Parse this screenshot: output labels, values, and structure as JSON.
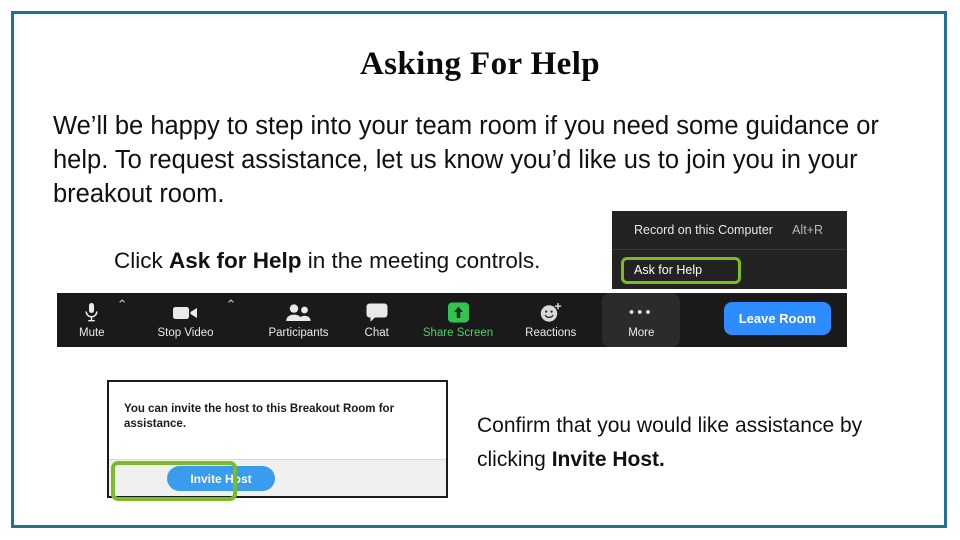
{
  "slide": {
    "title": "Asking For Help",
    "border_color": "#1F7391",
    "intro": "We’ll be happy to step into your team room if you need some guidance or help. To request assistance, let us know you’d like us to join you in your breakout room.",
    "click_instruction": {
      "before": "Click ",
      "bold": "Ask for Help",
      "after": " in the meeting controls."
    },
    "confirm_instruction": {
      "before": "Confirm that you would like assistance by clicking ",
      "bold": "Invite Host.",
      "after": ""
    }
  },
  "more_menu": {
    "background": "#232323",
    "highlight_color": "#79BC27",
    "items": [
      {
        "label": "Record on this Computer",
        "shortcut": "Alt+R"
      },
      {
        "label": "Ask for Help",
        "shortcut": ""
      }
    ]
  },
  "zoom_bar": {
    "background": "#1a1a1a",
    "share_screen_green": "#4fd06a",
    "leave_button_color": "#2D8CFF",
    "controls": [
      {
        "label": "Mute",
        "icon": "microphone-icon",
        "caret": "⌃"
      },
      {
        "label": "Stop Video",
        "icon": "video-camera-icon",
        "caret": "⌃"
      },
      {
        "label": "Participants",
        "icon": "participants-icon",
        "caret": ""
      },
      {
        "label": "Chat",
        "icon": "chat-bubble-icon",
        "caret": ""
      },
      {
        "label": "Share Screen",
        "icon": "share-screen-icon",
        "caret": ""
      },
      {
        "label": "Reactions",
        "icon": "reactions-smiley-icon",
        "caret": ""
      },
      {
        "label": "More",
        "icon": "more-ellipsis-icon",
        "caret": ""
      }
    ],
    "leave_label": "Leave Room"
  },
  "invite_dialog": {
    "message": "You can invite the host to this Breakout Room for assistance.",
    "button_label": "Invite Host",
    "button_color": "#3B9BED",
    "highlight_color": "#79BC27"
  }
}
